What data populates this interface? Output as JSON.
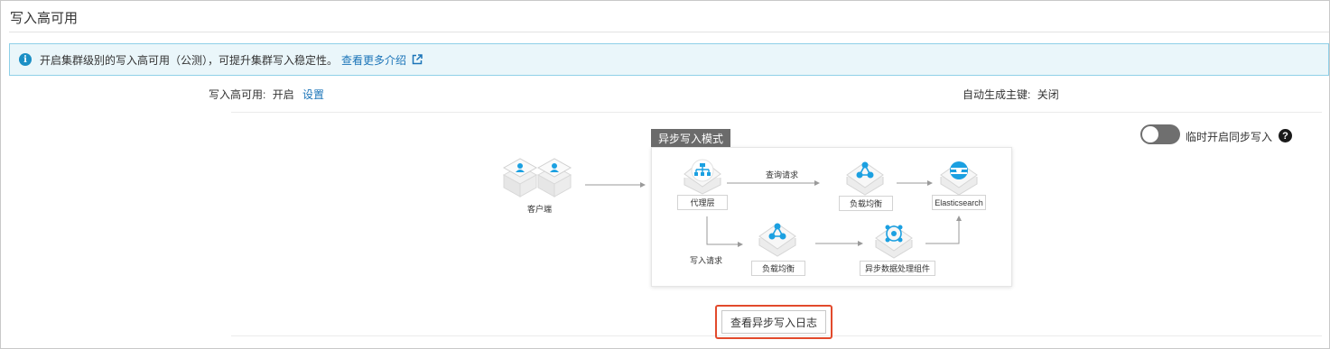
{
  "page": {
    "title": "写入高可用"
  },
  "notice": {
    "text": "开启集群级别的写入高可用（公测），可提升集群写入稳定性。",
    "link_label": "查看更多介绍"
  },
  "settings": {
    "ha_label": "写入高可用:",
    "ha_value": "开启",
    "ha_action": "设置",
    "auto_key_label": "自动生成主键:",
    "auto_key_value": "关闭"
  },
  "sync_toggle": {
    "label": "临时开启同步写入",
    "enabled": false,
    "help_glyph": "?"
  },
  "diagram": {
    "mode_title": "异步写入模式",
    "client_label": "客户端",
    "proxy_label": "代理层",
    "query_label": "查询请求",
    "write_label": "写入请求",
    "lb_top_label": "负载均衡",
    "lb_bottom_label": "负载均衡",
    "es_label": "Elasticsearch",
    "async_label": "异步数据处理组件"
  },
  "actions": {
    "view_log_label": "查看异步写入日志"
  },
  "colors": {
    "accent": "#1b74b8",
    "info_bg": "#eaf6fa",
    "info_border": "#8fd0e8",
    "highlight": "#e24a2c",
    "node_icon": "#1ba0e1"
  }
}
